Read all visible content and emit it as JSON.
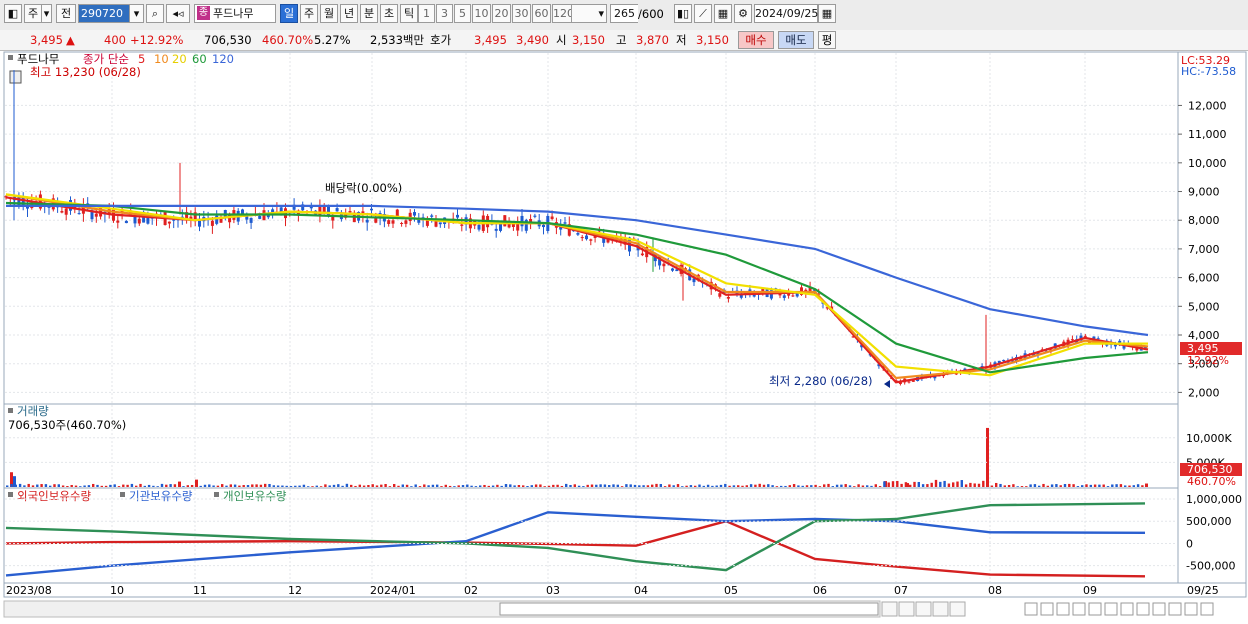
{
  "toolbar": {
    "market": "주",
    "prev": "전",
    "code": "290720",
    "name": "푸드나무",
    "period_tabs": [
      "일",
      "주",
      "월",
      "년",
      "분",
      "초",
      "틱"
    ],
    "interval_buttons": [
      "1",
      "3",
      "5",
      "10",
      "20",
      "30",
      "60",
      "120"
    ],
    "bars_shown": "265",
    "bars_total": "/600",
    "date": "2024/09/25",
    "search_icon": "search-icon",
    "settings_icon": "gear-icon"
  },
  "quote": {
    "price": "3,495",
    "arrow": "▲",
    "change": "400",
    "change_pct": "+12.92%",
    "volume": "706,530",
    "volume_ratio": "460.70%",
    "turnover": "5.27%",
    "amount": "2,533백만",
    "bid_label": "호가",
    "ask": "3,495",
    "bid": "3,490",
    "open_label": "시",
    "open": "3,150",
    "high_label": "고",
    "high": "3,870",
    "low_label": "저",
    "low": "3,150",
    "buy_label": "매수",
    "sell_label": "매도",
    "eval_label": "평"
  },
  "price_panel": {
    "name": "푸드나무",
    "legend_prefix": "종가 단순",
    "ma_periods": [
      "5",
      "10",
      "20",
      "60",
      "120"
    ],
    "ma_colors": [
      "#e02020",
      "#f08a1e",
      "#f2e000",
      "#1f9a3a",
      "#3a66d8"
    ],
    "high_label": "최고 13,230 (06/28)",
    "low_label": "최저 2,280 (06/28)",
    "dividend_label": "배당락(0.00%)",
    "lc": "LC:53.29",
    "hc": "HC:-73.58",
    "y_ticks": [
      "12,000",
      "11,000",
      "10,000",
      "9,000",
      "8,000",
      "7,000",
      "6,000",
      "5,000",
      "4,000",
      "3,000",
      "2,000"
    ],
    "current_tag": "3,495",
    "current_pct_tag": "12.92%"
  },
  "volume_panel": {
    "title": "거래량",
    "value": "706,530주(460.70%)",
    "y_ticks": [
      "10,000K",
      "5,000K"
    ],
    "current_tag": "706,530",
    "current_pct_tag": "460.70%"
  },
  "holding_panel": {
    "series": [
      {
        "name": "외국인보유수량",
        "color": "#d42020"
      },
      {
        "name": "기관보유수량",
        "color": "#2a5fd0"
      },
      {
        "name": "개인보유수량",
        "color": "#2f8f56"
      }
    ],
    "y_ticks": [
      "1,000,000",
      "500,000",
      "0",
      "-500,000"
    ]
  },
  "x_axis": {
    "labels": [
      "2023/08",
      "10",
      "11",
      "12",
      "2024/01",
      "02",
      "03",
      "04",
      "05",
      "06",
      "07",
      "08",
      "09"
    ],
    "right_label": "09/25"
  },
  "chart_data": [
    {
      "type": "line",
      "title": "",
      "x": [
        "2023/08",
        "2023/09",
        "2023/10",
        "2023/11",
        "2023/12",
        "2024/01",
        "2024/02",
        "2024/03",
        "2024/04",
        "2024/05",
        "2024/06",
        "2024/07",
        "2024/08",
        "2024/09"
      ],
      "series": [
        {
          "name": "5",
          "values": [
            8800,
            8200,
            8000,
            8300,
            8200,
            7900,
            7900,
            7100,
            5400,
            5500,
            2350,
            2900,
            3900,
            3495
          ]
        },
        {
          "name": "10",
          "values": [
            8900,
            8300,
            8000,
            8300,
            8200,
            7900,
            7900,
            7200,
            5500,
            5500,
            2500,
            2800,
            3800,
            3600
          ]
        },
        {
          "name": "20",
          "values": [
            8900,
            8400,
            8000,
            8300,
            8200,
            7900,
            7900,
            7300,
            5800,
            5400,
            2900,
            2600,
            3700,
            3700
          ]
        },
        {
          "name": "60",
          "values": [
            8600,
            8500,
            8200,
            8200,
            8100,
            8000,
            7900,
            7500,
            6800,
            5600,
            3700,
            2700,
            3200,
            3400
          ]
        },
        {
          "name": "120",
          "values": [
            8500,
            8500,
            8500,
            8500,
            8500,
            8400,
            8300,
            8000,
            7500,
            7000,
            6000,
            4900,
            4300,
            4000
          ]
        }
      ],
      "ylim": [
        1700,
        13200
      ],
      "xlabel": "",
      "ylabel": ""
    },
    {
      "type": "bar",
      "title": "",
      "categories": [
        "2023/08",
        "2023/10",
        "2023/11",
        "2024/06",
        "2024/07",
        "2024/08",
        "2024/09/25"
      ],
      "values": [
        3000,
        1100,
        1500,
        1200,
        800,
        12000,
        706.53
      ],
      "ylim": [
        0,
        13000
      ],
      "xlabel": "",
      "ylabel": ""
    },
    {
      "type": "line",
      "title": "",
      "x": [
        "2023/08",
        "2023/10",
        "2023/12",
        "2024/02",
        "2024/03",
        "2024/04",
        "2024/05",
        "2024/06",
        "2024/07",
        "2024/08",
        "2024/09"
      ],
      "series": [
        {
          "name": "외국인보유수량",
          "values": [
            0,
            30000,
            50000,
            20000,
            -10000,
            -50000,
            500000,
            -350000,
            -520000,
            -700000,
            -740000
          ]
        },
        {
          "name": "기관보유수량",
          "values": [
            -720000,
            -500000,
            -200000,
            50000,
            700000,
            600000,
            500000,
            550000,
            500000,
            250000,
            240000
          ]
        },
        {
          "name": "개인보유수량",
          "values": [
            350000,
            270000,
            100000,
            0,
            -100000,
            -400000,
            -600000,
            500000,
            550000,
            860000,
            900000
          ]
        }
      ],
      "ylim": [
        -800000,
        1000000
      ],
      "xlabel": "",
      "ylabel": ""
    }
  ]
}
